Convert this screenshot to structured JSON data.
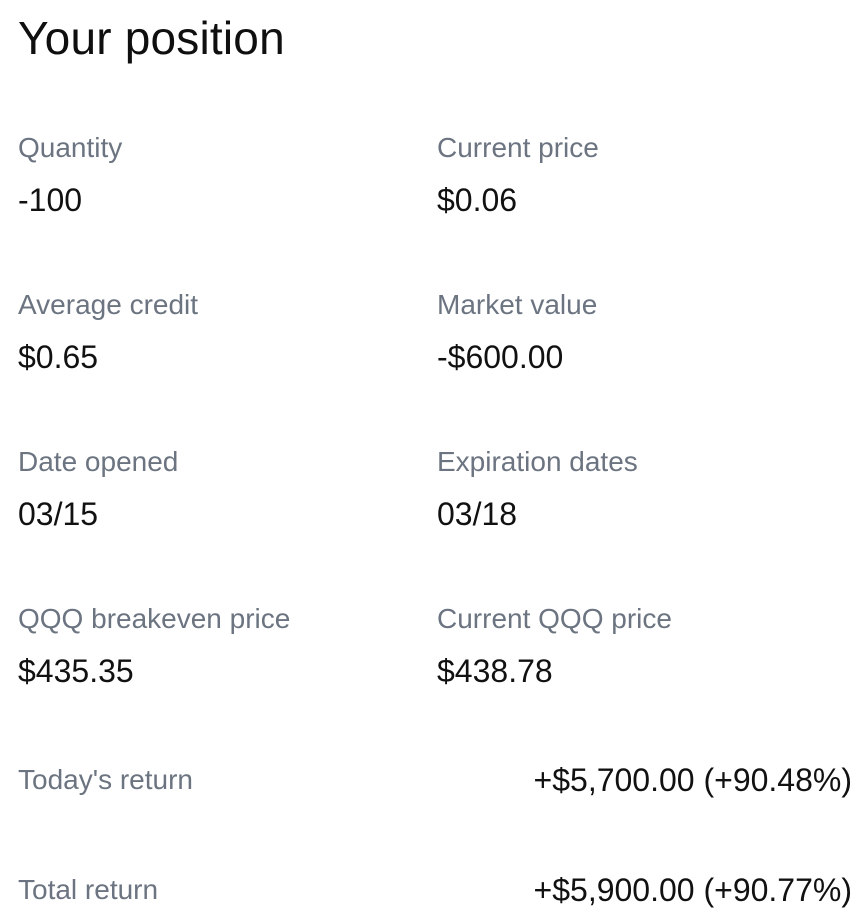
{
  "page": {
    "title": "Your position"
  },
  "position": {
    "quantity": {
      "label": "Quantity",
      "value": "-100"
    },
    "current_price": {
      "label": "Current price",
      "value": "$0.06"
    },
    "average_credit": {
      "label": "Average credit",
      "value": "$0.65"
    },
    "market_value": {
      "label": "Market value",
      "value": "-$600.00"
    },
    "date_opened": {
      "label": "Date opened",
      "value": "03/15"
    },
    "expiration_dates": {
      "label": "Expiration dates",
      "value": "03/18"
    },
    "breakeven_price": {
      "label": "QQQ breakeven price",
      "value": "$435.35"
    },
    "current_underlying_price": {
      "label": "Current QQQ price",
      "value": "$438.78"
    }
  },
  "returns": {
    "today": {
      "label": "Today's return",
      "value": "+$5,700.00 (+90.48%)"
    },
    "total": {
      "label": "Total return",
      "value": "+$5,900.00 (+90.77%)"
    }
  }
}
